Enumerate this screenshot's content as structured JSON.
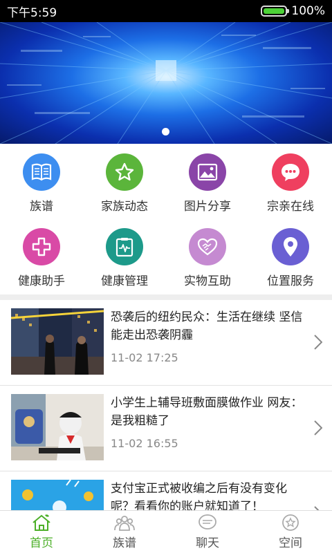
{
  "status": {
    "time": "下午5:59",
    "battery": "100%"
  },
  "banner": {
    "page_indicator_count": 1
  },
  "colors": {
    "accent": "#4caf28"
  },
  "grid": [
    {
      "label": "族谱",
      "icon": "book-icon",
      "color": "#3d8ef0"
    },
    {
      "label": "家族动态",
      "icon": "star-icon",
      "color": "#5bb53b"
    },
    {
      "label": "图片分享",
      "icon": "picture-icon",
      "color": "#8a45a8"
    },
    {
      "label": "宗亲在线",
      "icon": "chat-icon",
      "color": "#ef3f5f"
    },
    {
      "label": "健康助手",
      "icon": "medical-cross-icon",
      "color": "#d94aa6"
    },
    {
      "label": "健康管理",
      "icon": "health-monitor-icon",
      "color": "#1d9a8a"
    },
    {
      "label": "实物互助",
      "icon": "handshake-icon",
      "color": "#c58ad1"
    },
    {
      "label": "位置服务",
      "icon": "location-pin-icon",
      "color": "#6a5fd3"
    }
  ],
  "news": [
    {
      "title": "恐袭后的纽约民众：生活在继续 坚信能走出恐袭阴霾",
      "time": "11-02 17:25"
    },
    {
      "title": "小学生上辅导班敷面膜做作业 网友：是我粗糙了",
      "time": "11-02 16:55"
    },
    {
      "title": "支付宝正式被收编之后有没有变化呢？看看你的账户就知道了！",
      "time": ""
    }
  ],
  "tabs": [
    {
      "label": "首页",
      "icon": "home-icon",
      "active": true
    },
    {
      "label": "族谱",
      "icon": "family-icon",
      "active": false
    },
    {
      "label": "聊天",
      "icon": "chat-bubble-icon",
      "active": false
    },
    {
      "label": "空间",
      "icon": "space-icon",
      "active": false
    }
  ]
}
